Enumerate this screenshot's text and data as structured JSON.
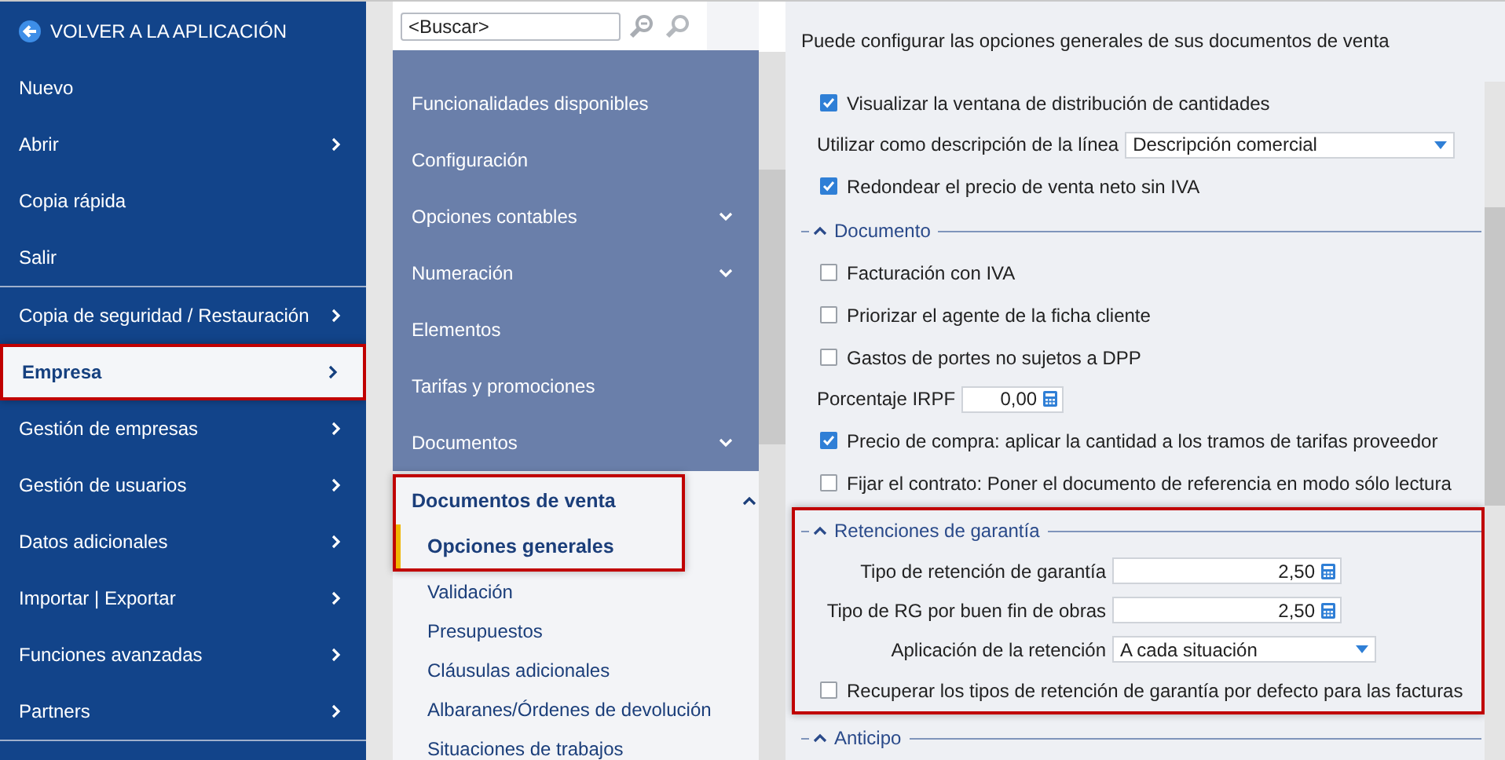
{
  "sidebar": {
    "back_label": "VOLVER A LA APLICACIÓN",
    "groups": [
      [
        {
          "label": "Nuevo",
          "has_submenu": false,
          "selected": false
        },
        {
          "label": "Abrir",
          "has_submenu": true,
          "selected": false
        },
        {
          "label": "Copia rápida",
          "has_submenu": false,
          "selected": false
        },
        {
          "label": "Salir",
          "has_submenu": false,
          "selected": false
        }
      ],
      [
        {
          "label": "Copia de seguridad / Restauración",
          "has_submenu": true,
          "selected": false
        },
        {
          "label": "Empresa",
          "has_submenu": true,
          "selected": true
        },
        {
          "label": "Gestión de empresas",
          "has_submenu": true,
          "selected": false
        },
        {
          "label": "Gestión de usuarios",
          "has_submenu": true,
          "selected": false
        },
        {
          "label": "Datos adicionales",
          "has_submenu": true,
          "selected": false
        },
        {
          "label": "Importar | Exportar",
          "has_submenu": true,
          "selected": false
        },
        {
          "label": "Funciones avanzadas",
          "has_submenu": true,
          "selected": false
        },
        {
          "label": "Partners",
          "has_submenu": true,
          "selected": false
        }
      ]
    ]
  },
  "search": {
    "placeholder": "<Buscar>"
  },
  "nav": {
    "items": [
      {
        "label": "Funcionalidades disponibles",
        "kind": "link"
      },
      {
        "label": "Configuración",
        "kind": "link"
      },
      {
        "label": "Opciones contables",
        "kind": "folder",
        "expanded": false
      },
      {
        "label": "Numeración",
        "kind": "folder",
        "expanded": false
      },
      {
        "label": "Elementos",
        "kind": "link"
      },
      {
        "label": "Tarifas y promociones",
        "kind": "link"
      },
      {
        "label": "Documentos",
        "kind": "folder",
        "expanded": false
      }
    ],
    "group": {
      "label": "Documentos de venta",
      "expanded": true,
      "highlighted": true,
      "children": [
        {
          "label": "Opciones generales",
          "selected": true,
          "highlighted": true
        },
        {
          "label": "Validación",
          "selected": false,
          "highlighted": false
        },
        {
          "label": "Presupuestos",
          "selected": false,
          "highlighted": false
        },
        {
          "label": "Cláusulas adicionales",
          "selected": false,
          "highlighted": false
        },
        {
          "label": "Albaranes/Órdenes de devolución",
          "selected": false,
          "highlighted": false
        },
        {
          "label": "Situaciones de trabajos",
          "selected": false,
          "highlighted": false
        }
      ]
    }
  },
  "content": {
    "intro": "Puede configurar las opciones generales de sus documentos de venta",
    "rows": [
      {
        "kind": "checkbox",
        "label": "Visualizar la ventana de distribución de cantidades",
        "checked": true
      },
      {
        "kind": "select",
        "label": "Utilizar como descripción de la línea",
        "value": "Descripción comercial"
      },
      {
        "kind": "checkbox",
        "label": "Redondear el precio de venta neto sin IVA",
        "checked": true
      }
    ],
    "sections": [
      {
        "title": "Documento",
        "expanded": true,
        "highlighted": false,
        "rows": [
          {
            "kind": "checkbox",
            "label": "Facturación con IVA",
            "checked": false
          },
          {
            "kind": "checkbox",
            "label": "Priorizar el agente de la ficha cliente",
            "checked": false
          },
          {
            "kind": "checkbox",
            "label": "Gastos de portes no sujetos a DPP",
            "checked": false
          },
          {
            "kind": "number",
            "label": "Porcentaje IRPF",
            "value": "0,00"
          },
          {
            "kind": "checkbox",
            "label": "Precio de compra: aplicar la cantidad a los tramos de tarifas proveedor",
            "checked": true
          },
          {
            "kind": "checkbox",
            "label": "Fijar el contrato: Poner el documento de referencia en modo sólo lectura",
            "checked": false
          }
        ]
      },
      {
        "title": "Retenciones de garantía",
        "expanded": true,
        "highlighted": true,
        "rows": [
          {
            "kind": "number",
            "label": "Tipo de retención de garantía",
            "value": "2,50"
          },
          {
            "kind": "number",
            "label": "Tipo de RG por buen fin de obras",
            "value": "2,50"
          },
          {
            "kind": "select",
            "label": "Aplicación de la retención",
            "value": "A cada situación"
          },
          {
            "kind": "checkbox",
            "label": "Recuperar los tipos de retención de garantía por defecto para las facturas",
            "checked": false
          }
        ]
      },
      {
        "title": "Anticipo",
        "expanded": true,
        "highlighted": false
      }
    ]
  }
}
